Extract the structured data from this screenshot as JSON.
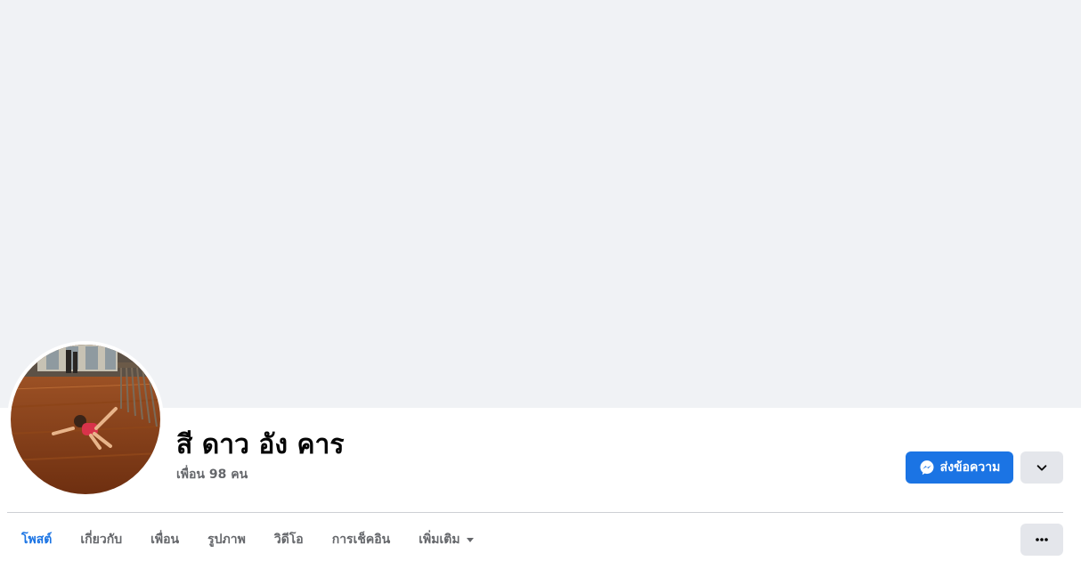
{
  "profile": {
    "name": "สี ดาว อัง คาร",
    "friends_text": "เพื่อน 98 คน"
  },
  "actions": {
    "message_label": "ส่งข้อความ",
    "message_icon": "messenger-icon",
    "dropdown_icon": "chevron-down-icon",
    "more_icon": "more-horizontal-icon"
  },
  "tabs": [
    {
      "label": "โพสต์",
      "active": true
    },
    {
      "label": "เกี่ยวกับ",
      "active": false
    },
    {
      "label": "เพื่อน",
      "active": false
    },
    {
      "label": "รูปภาพ",
      "active": false
    },
    {
      "label": "วิดีโอ",
      "active": false
    },
    {
      "label": "การเช็คอิน",
      "active": false
    },
    {
      "label": "เพิ่มเติม",
      "active": false,
      "icon": "caret-down-icon"
    }
  ],
  "colors": {
    "accent": "#1b74e4",
    "cover_bg": "#f0f2f5",
    "secondary_text": "#65676b",
    "button_gray": "#e4e6eb"
  }
}
